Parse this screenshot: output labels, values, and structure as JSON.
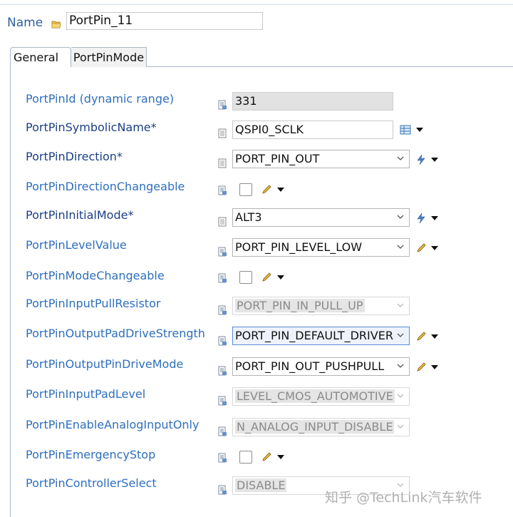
{
  "header": {
    "name_label": "Name",
    "name_value": "PortPin_11"
  },
  "tabs": [
    {
      "label": "General",
      "active": true
    },
    {
      "label": "PortPinMode",
      "active": false
    }
  ],
  "params": [
    {
      "label": "PortPinId (dynamic range)",
      "value": "331",
      "kind": "readonly"
    },
    {
      "label": "PortPinSymbolicName*",
      "value": "QSPI0_SCLK",
      "kind": "text"
    },
    {
      "label": "PortPinDirection*",
      "value": "PORT_PIN_OUT",
      "kind": "combo"
    },
    {
      "label": "PortPinDirectionChangeable",
      "value": "",
      "kind": "checkbox"
    },
    {
      "label": "PortPinInitialMode*",
      "value": "ALT3",
      "kind": "combo"
    },
    {
      "label": "PortPinLevelValue",
      "value": "PORT_PIN_LEVEL_LOW",
      "kind": "combo"
    },
    {
      "label": "PortPinModeChangeable",
      "value": "",
      "kind": "checkbox"
    },
    {
      "label": "PortPinInputPullResistor",
      "value": "PORT_PIN_IN_PULL_UP",
      "kind": "combo-disabled"
    },
    {
      "label": "PortPinOutputPadDriveStrength",
      "value": "PORT_PIN_DEFAULT_DRIVER",
      "kind": "combo-focused"
    },
    {
      "label": "PortPinOutputPinDriveMode",
      "value": "PORT_PIN_OUT_PUSHPULL",
      "kind": "combo"
    },
    {
      "label": "PortPinInputPadLevel",
      "value": "LEVEL_CMOS_AUTOMOTIVE",
      "kind": "combo-disabled"
    },
    {
      "label": "PortPinEnableAnalogInputOnly",
      "value": "N_ANALOG_INPUT_DISABLE",
      "kind": "combo-disabled"
    },
    {
      "label": "PortPinEmergencyStop",
      "value": "",
      "kind": "checkbox"
    },
    {
      "label": "PortPinControllerSelect",
      "value": "DISABLE",
      "kind": "combo-disabled"
    }
  ],
  "watermark": "知乎 @TechLink汽车软件",
  "colors": {
    "label_blue": "#2e6fbd",
    "label_required": "#1b3f85",
    "readonly_bg": "#e2e2e2",
    "focus_border": "#5c8bd6"
  }
}
